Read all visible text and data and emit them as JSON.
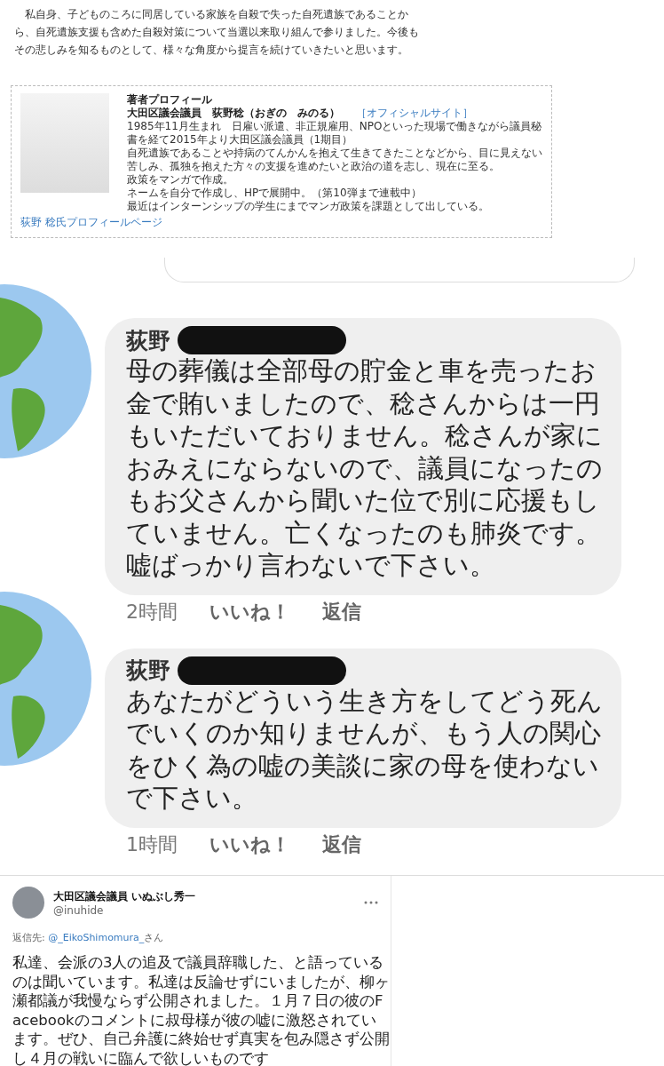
{
  "article": {
    "paragraph": "私自身、子どものころに同居している家族を自殺で失った自死遺族であることから、自死遺族支援も含めた自殺対策について当選以来取り組んで参りました。今後もその悲しみを知るものとして、様々な角度から提言を続けていきたいと思います。",
    "profile": {
      "heading": "著者プロフィール",
      "title": "大田区議会議員　荻野稔（おぎの　みのる）",
      "site_link": "［オフィシャルサイト］",
      "bio": [
        "1985年11月生まれ　日雇い派遣、非正規雇用、NPOといった現場で働きながら議員秘書を経て2015年より大田区議会議員（1期目）",
        "自死遺族であることや持病のてんかんを抱えて生きてきたことなどから、目に見えない苦しみ、孤独を抱えた方々の支援を進めたいと政治の道を志し、現在に至る。",
        "政策をマンガで作成。",
        "ネームを自分で作成し、HPで展開中。（第10弾まで連載中）",
        "最近はインターンシップの学生にまでマンガ政策を課題として出している。"
      ],
      "profile_link": "荻野 稔氏プロフィールページ"
    }
  },
  "comments": [
    {
      "author": "荻野",
      "text": "母の葬儀は全部母の貯金と車を売ったお金で賄いましたので、稔さんからは一円もいただいておりません。稔さんが家におみえにならないので、議員になったのもお父さんから聞いた位で別に応援もしていません。亡くなったのも肺炎です。嘘ばっかり言わないで下さい。",
      "time": "2時間",
      "like": "いいね！",
      "reply": "返信"
    },
    {
      "author": "荻野",
      "text": "あなたがどういう生き方をしてどう死んでいくのか知りませんが、もう人の関心をひく為の嘘の美談に家の母を使わないで下さい。",
      "time": "1時間",
      "like": "いいね！",
      "reply": "返信"
    }
  ],
  "tweet": {
    "name": "大田区議会議員 いぬぶし秀一",
    "handle": "@inuhide",
    "reply_prefix": "返信先: ",
    "reply_to": "@_EikoShimomura_",
    "reply_suffix": "さん",
    "text": "私達、会派の3人の追及で議員辞職した、と語っているのは聞いています。私達は反論せずにいましたが、柳ヶ瀬都議が我慢ならず公開されました。１月７日の彼のFacebookのコメントに叔母様が彼の嘘に激怒されています。ぜひ、自己弁護に終始せず真実を包み隠さず公開し４月の戦いに臨んで欲しいものです"
  }
}
